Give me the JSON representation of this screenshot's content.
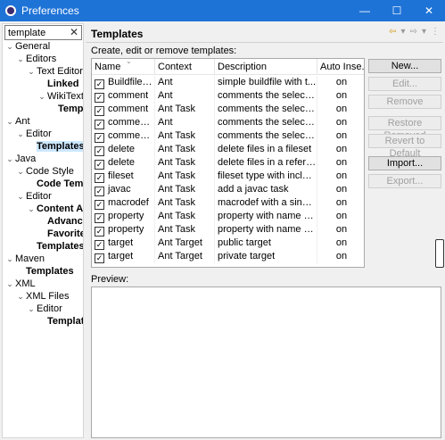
{
  "window": {
    "title": "Preferences",
    "controls": {
      "minimize": "—",
      "maximize": "☐",
      "close": "✕"
    }
  },
  "filter": {
    "value": "template",
    "clear": "✕"
  },
  "tree": [
    {
      "label": "General",
      "level": 0,
      "expanded": true
    },
    {
      "label": "Editors",
      "level": 1,
      "expanded": true
    },
    {
      "label": "Text Editors",
      "level": 2,
      "expanded": true
    },
    {
      "label": "Linked",
      "level": 3,
      "bold": true
    },
    {
      "label": "WikiText",
      "level": 3,
      "expanded": true
    },
    {
      "label": "Templates",
      "level": 4,
      "bold": true
    },
    {
      "label": "Ant",
      "level": 0,
      "expanded": true
    },
    {
      "label": "Editor",
      "level": 1,
      "expanded": true
    },
    {
      "label": "Templates",
      "level": 2,
      "bold": true,
      "selected": true
    },
    {
      "label": "Java",
      "level": 0,
      "expanded": true
    },
    {
      "label": "Code Style",
      "level": 1,
      "expanded": true
    },
    {
      "label": "Code Templates",
      "level": 2,
      "bold": true
    },
    {
      "label": "Editor",
      "level": 1,
      "expanded": true
    },
    {
      "label": "Content Assist",
      "level": 2,
      "bold": true,
      "expanded": true
    },
    {
      "label": "Advanced",
      "level": 3,
      "bold": true
    },
    {
      "label": "Favorites",
      "level": 3,
      "bold": true
    },
    {
      "label": "Templates",
      "level": 2,
      "bold": true
    },
    {
      "label": "Maven",
      "level": 0,
      "expanded": true
    },
    {
      "label": "Templates",
      "level": 1,
      "bold": true
    },
    {
      "label": "XML",
      "level": 0,
      "expanded": true
    },
    {
      "label": "XML Files",
      "level": 1,
      "expanded": true
    },
    {
      "label": "Editor",
      "level": 2,
      "expanded": true
    },
    {
      "label": "Templates",
      "level": 3,
      "bold": true
    }
  ],
  "page": {
    "title": "Templates",
    "subtitle": "Create, edit or remove templates:",
    "preview_label": "Preview:"
  },
  "table": {
    "columns": [
      "Name",
      "Context",
      "Description",
      "Auto Inse..."
    ],
    "rows": [
      {
        "checked": true,
        "name": "Buildfile t...",
        "context": "Ant",
        "description": "simple buildfile with t...",
        "auto": "on"
      },
      {
        "checked": true,
        "name": "comment",
        "context": "Ant",
        "description": "comments the selecte...",
        "auto": "on"
      },
      {
        "checked": true,
        "name": "comment",
        "context": "Ant Task",
        "description": "comments the selecte...",
        "auto": "on"
      },
      {
        "checked": true,
        "name": "comment...",
        "context": "Ant",
        "description": "comments the selecte...",
        "auto": "on"
      },
      {
        "checked": true,
        "name": "comment...",
        "context": "Ant Task",
        "description": "comments the selecte...",
        "auto": "on"
      },
      {
        "checked": true,
        "name": "delete",
        "context": "Ant Task",
        "description": "delete files in a fileset",
        "auto": "on"
      },
      {
        "checked": true,
        "name": "delete",
        "context": "Ant Task",
        "description": "delete files in a referen...",
        "auto": "on"
      },
      {
        "checked": true,
        "name": "fileset",
        "context": "Ant Task",
        "description": "fileset type with includ...",
        "auto": "on"
      },
      {
        "checked": true,
        "name": "javac",
        "context": "Ant Task",
        "description": "add a javac task",
        "auto": "on"
      },
      {
        "checked": true,
        "name": "macrodef",
        "context": "Ant Task",
        "description": "macrodef with a single...",
        "auto": "on"
      },
      {
        "checked": true,
        "name": "property",
        "context": "Ant Task",
        "description": "property with name an...",
        "auto": "on"
      },
      {
        "checked": true,
        "name": "property",
        "context": "Ant Task",
        "description": "property with name an...",
        "auto": "on"
      },
      {
        "checked": true,
        "name": "target",
        "context": "Ant Target",
        "description": "public target",
        "auto": "on"
      },
      {
        "checked": true,
        "name": "target",
        "context": "Ant Target",
        "description": "private target",
        "auto": "on"
      }
    ]
  },
  "buttons": {
    "new": "New...",
    "edit": "Edit...",
    "remove": "Remove",
    "restore_removed": "Restore Removed",
    "revert_default": "Revert to Default",
    "import": "Import...",
    "export": "Export..."
  },
  "icons": {
    "back": "back-arrow-icon",
    "forward": "forward-arrow-icon",
    "menu": "view-menu-icon"
  }
}
